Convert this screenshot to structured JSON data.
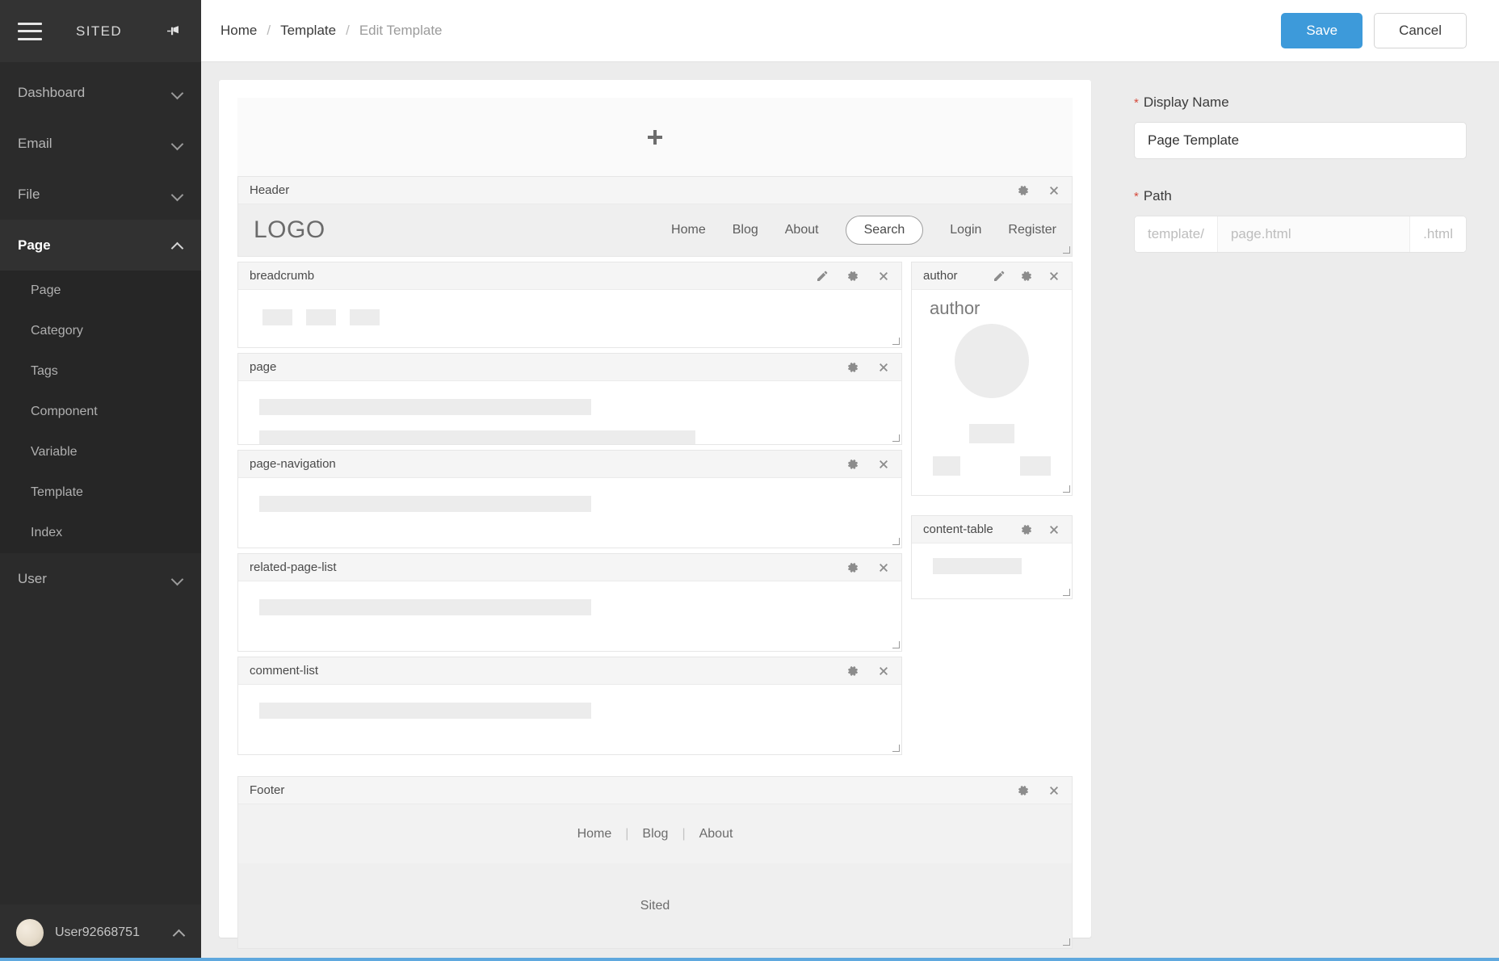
{
  "sidebar": {
    "brand": "SITED",
    "menu_icon": "hamburger-icon",
    "pin_icon": "pin-icon",
    "groups": [
      {
        "label": "Dashboard",
        "expanded": false
      },
      {
        "label": "Email",
        "expanded": false
      },
      {
        "label": "File",
        "expanded": false
      },
      {
        "label": "Page",
        "expanded": true
      },
      {
        "label": "User",
        "expanded": false
      }
    ],
    "page_children": [
      "Page",
      "Category",
      "Tags",
      "Component",
      "Variable",
      "Template",
      "Index"
    ],
    "user": {
      "name": "User92668751",
      "avatar": "user-avatar"
    }
  },
  "topbar": {
    "breadcrumb": [
      {
        "label": "Home",
        "current": false
      },
      {
        "label": "Template",
        "current": false
      },
      {
        "label": "Edit Template",
        "current": true
      }
    ],
    "separator": "/",
    "save_label": "Save",
    "cancel_label": "Cancel",
    "accent_color": "#3d9ada"
  },
  "panel": {
    "display_name": {
      "label": "Display Name",
      "required": "*",
      "value": "Page Template"
    },
    "path": {
      "label": "Path",
      "required": "*",
      "prefix": "template/",
      "placeholder": "page.html",
      "suffix": ".html"
    },
    "required_color": "#d64a3c"
  },
  "canvas": {
    "add_zone": {
      "icon": "plus-icon",
      "label": ""
    },
    "blocks": {
      "header": {
        "title": "Header",
        "tools": [
          "gear-icon",
          "close-icon"
        ],
        "logo": "LOGO",
        "nav": [
          "Home",
          "Blog",
          "About"
        ],
        "search_label": "Search",
        "nav_right": [
          "Login",
          "Register"
        ]
      },
      "breadcrumb": {
        "title": "breadcrumb",
        "tools": [
          "pencil-icon",
          "gear-icon",
          "close-icon"
        ]
      },
      "page": {
        "title": "page",
        "tools": [
          "gear-icon",
          "close-icon"
        ]
      },
      "page_navigation": {
        "title": "page-navigation",
        "tools": [
          "gear-icon",
          "close-icon"
        ]
      },
      "related_page_list": {
        "title": "related-page-list",
        "tools": [
          "gear-icon",
          "close-icon"
        ]
      },
      "comment_list": {
        "title": "comment-list",
        "tools": [
          "gear-icon",
          "close-icon"
        ]
      },
      "author": {
        "title": "author",
        "tools": [
          "pencil-icon",
          "gear-icon",
          "close-icon"
        ],
        "heading": "author"
      },
      "content_table": {
        "title": "content-table",
        "tools": [
          "gear-icon",
          "close-icon"
        ]
      },
      "footer": {
        "title": "Footer",
        "tools": [
          "gear-icon",
          "close-icon"
        ],
        "nav": [
          "Home",
          "Blog",
          "About"
        ],
        "divider": "|",
        "site_name": "Sited"
      }
    }
  }
}
